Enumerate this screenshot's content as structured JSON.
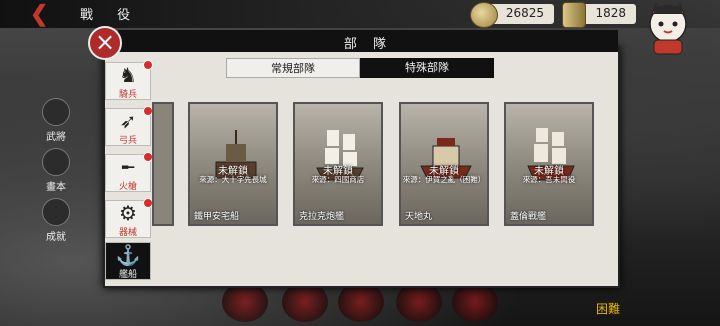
{
  "header": {
    "title": "戰 役"
  },
  "resources": {
    "coins": "26825",
    "ingots": "1828"
  },
  "left_menu": [
    {
      "label": "武將"
    },
    {
      "label": "畫本"
    },
    {
      "label": "成就"
    }
  ],
  "difficulty": "困難",
  "panel": {
    "title": "部 隊",
    "close_label": "×",
    "tabs": {
      "normal": "常規部隊",
      "special": "特殊部隊",
      "active": "special"
    },
    "sidebar": [
      {
        "label": "騎兵",
        "icon": "horse-icon",
        "badge": true
      },
      {
        "label": "弓兵",
        "icon": "bow-icon",
        "badge": true
      },
      {
        "label": "火槍",
        "icon": "musket-icon",
        "badge": true
      },
      {
        "label": "器械",
        "icon": "cannon-icon",
        "badge": true
      },
      {
        "label": "艦船",
        "icon": "anchor-icon",
        "badge": false,
        "active": true
      }
    ],
    "cards": [
      {
        "name": "鐵甲安宅船",
        "status": "未解鎖",
        "hint": "來源：大十字先長城"
      },
      {
        "name": "克拉克炮艦",
        "status": "未解鎖",
        "hint": "來源：四國商店"
      },
      {
        "name": "天地丸",
        "status": "未解鎖",
        "hint": "來源：伊賀之亂（困難）"
      },
      {
        "name": "蓋倫戰艦",
        "status": "未解鎖",
        "hint": "來源：吾未間役"
      }
    ]
  },
  "colors": {
    "accent_red": "#d92b2b",
    "panel_bg": "#e6e3dd",
    "dark": "#111111"
  }
}
